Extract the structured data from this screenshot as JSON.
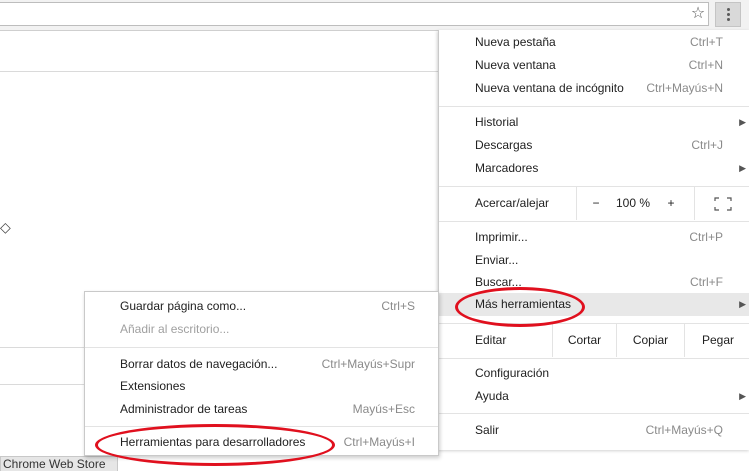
{
  "toolbar": {
    "star_icon": "☆",
    "menu_icon": "vertical-dots"
  },
  "page": {
    "arrow_glyph": "◇",
    "tab_label": "Chrome Web Store"
  },
  "menu": {
    "items": [
      {
        "label": "Nueva pestaña",
        "shortcut": "Ctrl+T"
      },
      {
        "label": "Nueva ventana",
        "shortcut": "Ctrl+N"
      },
      {
        "label": "Nueva ventana de incógnito",
        "shortcut": "Ctrl+Mayús+N"
      },
      {
        "label": "Historial",
        "shortcut": ""
      },
      {
        "label": "Descargas",
        "shortcut": "Ctrl+J"
      },
      {
        "label": "Marcadores",
        "shortcut": ""
      },
      {
        "label": "Imprimir...",
        "shortcut": "Ctrl+P"
      },
      {
        "label": "Enviar...",
        "shortcut": ""
      },
      {
        "label": "Buscar...",
        "shortcut": "Ctrl+F"
      },
      {
        "label": "Más herramientas",
        "shortcut": ""
      },
      {
        "label": "Configuración",
        "shortcut": ""
      },
      {
        "label": "Ayuda",
        "shortcut": ""
      },
      {
        "label": "Salir",
        "shortcut": "Ctrl+Mayús+Q"
      }
    ],
    "zoom": {
      "label": "Acercar/alejar",
      "minus": "−",
      "value": "100 %",
      "plus": "+"
    },
    "edit": {
      "label": "Editar",
      "cut": "Cortar",
      "copy": "Copiar",
      "paste": "Pegar"
    }
  },
  "submenu": {
    "items": [
      {
        "label": "Guardar página como...",
        "shortcut": "Ctrl+S"
      },
      {
        "label": "Añadir al escritorio...",
        "shortcut": ""
      },
      {
        "label": "Borrar datos de navegación...",
        "shortcut": "Ctrl+Mayús+Supr"
      },
      {
        "label": "Extensiones",
        "shortcut": ""
      },
      {
        "label": "Administrador de tareas",
        "shortcut": "Mayús+Esc"
      },
      {
        "label": "Herramientas para desarrolladores",
        "shortcut": "Ctrl+Mayús+I"
      }
    ]
  },
  "colors": {
    "annotation": "#e0101e",
    "highlight": "#e8e8e8"
  }
}
